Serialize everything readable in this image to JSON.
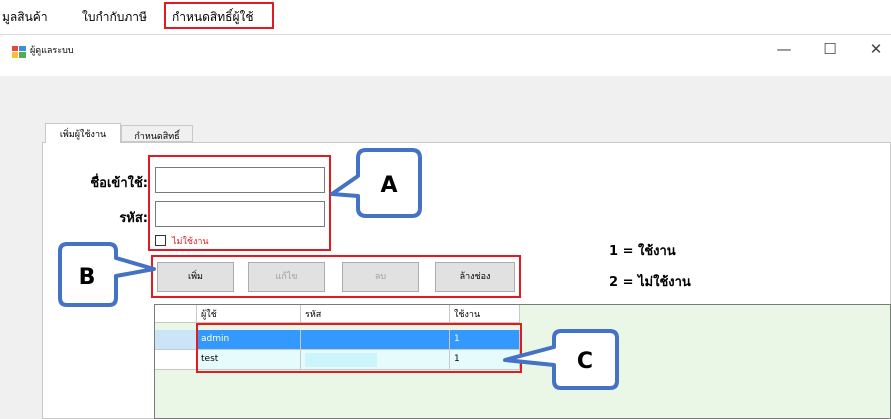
{
  "menubar": {
    "items": [
      "มูลสินค้า",
      "ใบกำกับภาษี",
      "กำหนดสิทธิ์ผู้ใช้"
    ]
  },
  "window": {
    "title": "ผู้ดูแลระบบ",
    "minimize": "—",
    "maximize": "☐",
    "close": "✕"
  },
  "tabs": [
    "เพิ่มผู้ใช้งาน",
    "กำหนดสิทธิ์"
  ],
  "form": {
    "username_label": "ชื่อเข้าใช้:",
    "username_value": "",
    "password_label": "รหัส:",
    "password_value": "",
    "inactive_checkbox_label": "ไม่ใช้งาน",
    "inactive_checked": false
  },
  "buttons": {
    "add": "เพิ่ม",
    "edit": "แก้ไข",
    "delete": "ลบ",
    "clear": "ล้างช่อง"
  },
  "legend": {
    "line1": "1 = ใช้งาน",
    "line2": "2 = ไม่ใช้งาน"
  },
  "grid": {
    "columns": [
      "ผู้ใช้",
      "รหัส",
      "ใช้งาน"
    ],
    "rows": [
      {
        "user": "admin",
        "password": "",
        "active": "1"
      },
      {
        "user": "test",
        "password": "",
        "active": "1"
      }
    ]
  },
  "callouts": {
    "a": "A",
    "b": "B",
    "c": "C"
  },
  "colors": {
    "highlight_red": "#e11b22",
    "callout_blue": "#4472c4",
    "selection_blue": "#3399ff",
    "grid_bg": "#eaf7e6"
  }
}
